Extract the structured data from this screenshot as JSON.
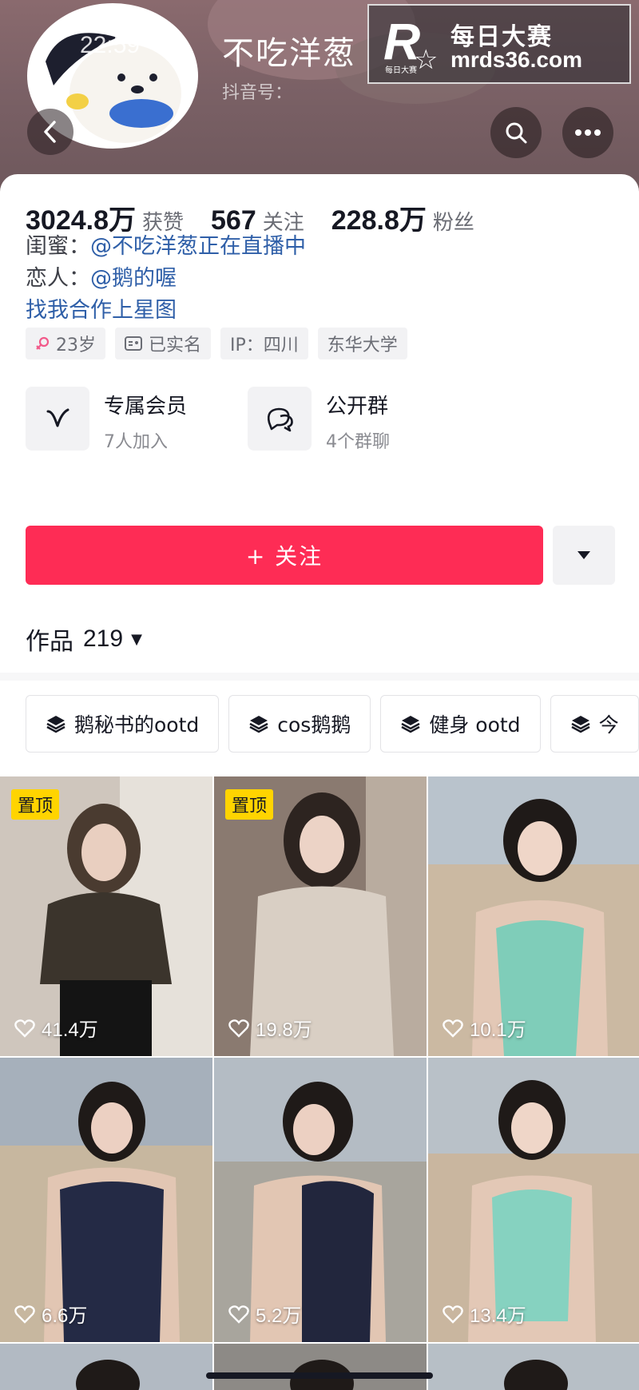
{
  "header": {
    "status_time": "22:59",
    "nickname": "不吃洋葱",
    "douyin_id_label": "抖音号：",
    "watermark": {
      "cn": "每日大赛",
      "url": "mrds36.com",
      "logo_letter": "R",
      "logo_small": "每日大赛"
    }
  },
  "stats": [
    {
      "value": "3024.8万",
      "label": "获赞"
    },
    {
      "value": "567",
      "label": "关注"
    },
    {
      "value": "228.8万",
      "label": "粉丝"
    }
  ],
  "bio": {
    "bestie_label": "闺蜜：",
    "bestie_mention": "@不吃洋葱正在直播中",
    "lover_label": "恋人：",
    "lover_mention": "@鹅的喔",
    "link": "找我合作上星图"
  },
  "tags": [
    {
      "icon": "female-icon",
      "text": "23岁"
    },
    {
      "icon": "id-card-icon",
      "text": "已实名"
    },
    {
      "icon": "",
      "text": "IP：四川"
    },
    {
      "icon": "",
      "text": "东华大学"
    }
  ],
  "features": [
    {
      "icon": "v-member-icon",
      "title": "专属会员",
      "subtitle": "7人加入"
    },
    {
      "icon": "group-chat-icon",
      "title": "公开群",
      "subtitle": "4个群聊"
    }
  ],
  "follow_button": "+ 关注",
  "works": {
    "label": "作品",
    "count": "219"
  },
  "collections": [
    "鹅秘书的ootd",
    "cos鹅鹅",
    "健身 ootd",
    "今"
  ],
  "videos": [
    {
      "pinned": true,
      "pin_label": "置顶",
      "likes": "41.4万"
    },
    {
      "pinned": true,
      "pin_label": "置顶",
      "likes": "19.8万"
    },
    {
      "pinned": false,
      "likes": "10.1万"
    },
    {
      "pinned": false,
      "likes": "6.6万"
    },
    {
      "pinned": false,
      "likes": "5.2万"
    },
    {
      "pinned": false,
      "likes": "13.4万"
    }
  ],
  "colors": {
    "accent": "#fe2c55",
    "link": "#2f5fa8",
    "pin": "#ffd400"
  }
}
